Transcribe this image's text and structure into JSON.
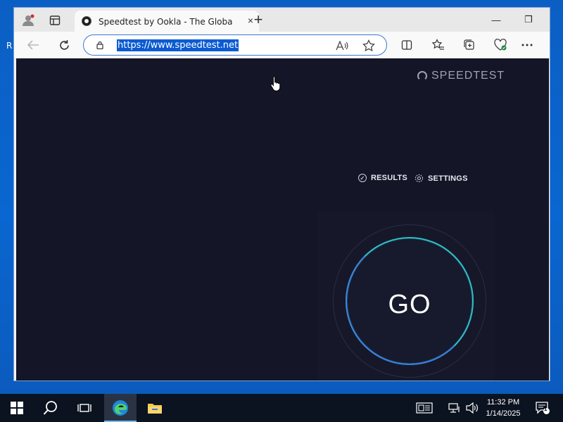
{
  "desktop": {
    "fragment_text": "R"
  },
  "browser": {
    "tab": {
      "title": "Speedtest by Ookla - The Global Br",
      "close_glyph": "×"
    },
    "new_tab_glyph": "+",
    "window_controls": {
      "minimize": "—",
      "restore": "❐"
    },
    "address": {
      "url": "https://www.speedtest.net"
    }
  },
  "page": {
    "brand": "SPEEDTEST",
    "nav": {
      "results": "RESULTS",
      "settings": "SETTINGS"
    },
    "go_label": "GO",
    "colors": {
      "background": "#141526",
      "ring": "#2ec2c8",
      "ring_accent": "#3b7fe0"
    }
  },
  "taskbar": {
    "time": "11:32 PM",
    "date": "1/14/2025",
    "notification_count": "1"
  },
  "icons": {
    "profile": "profile-icon",
    "tabs": "tab-actions-icon",
    "back": "back-arrow-icon",
    "refresh": "refresh-icon",
    "lock": "lock-icon",
    "read_aloud": "read-aloud-icon",
    "favorite": "favorite-star-icon",
    "split": "split-screen-icon",
    "favorites": "favorites-icon",
    "collections": "collections-icon",
    "health": "browser-essentials-icon",
    "more": "more-icon"
  }
}
